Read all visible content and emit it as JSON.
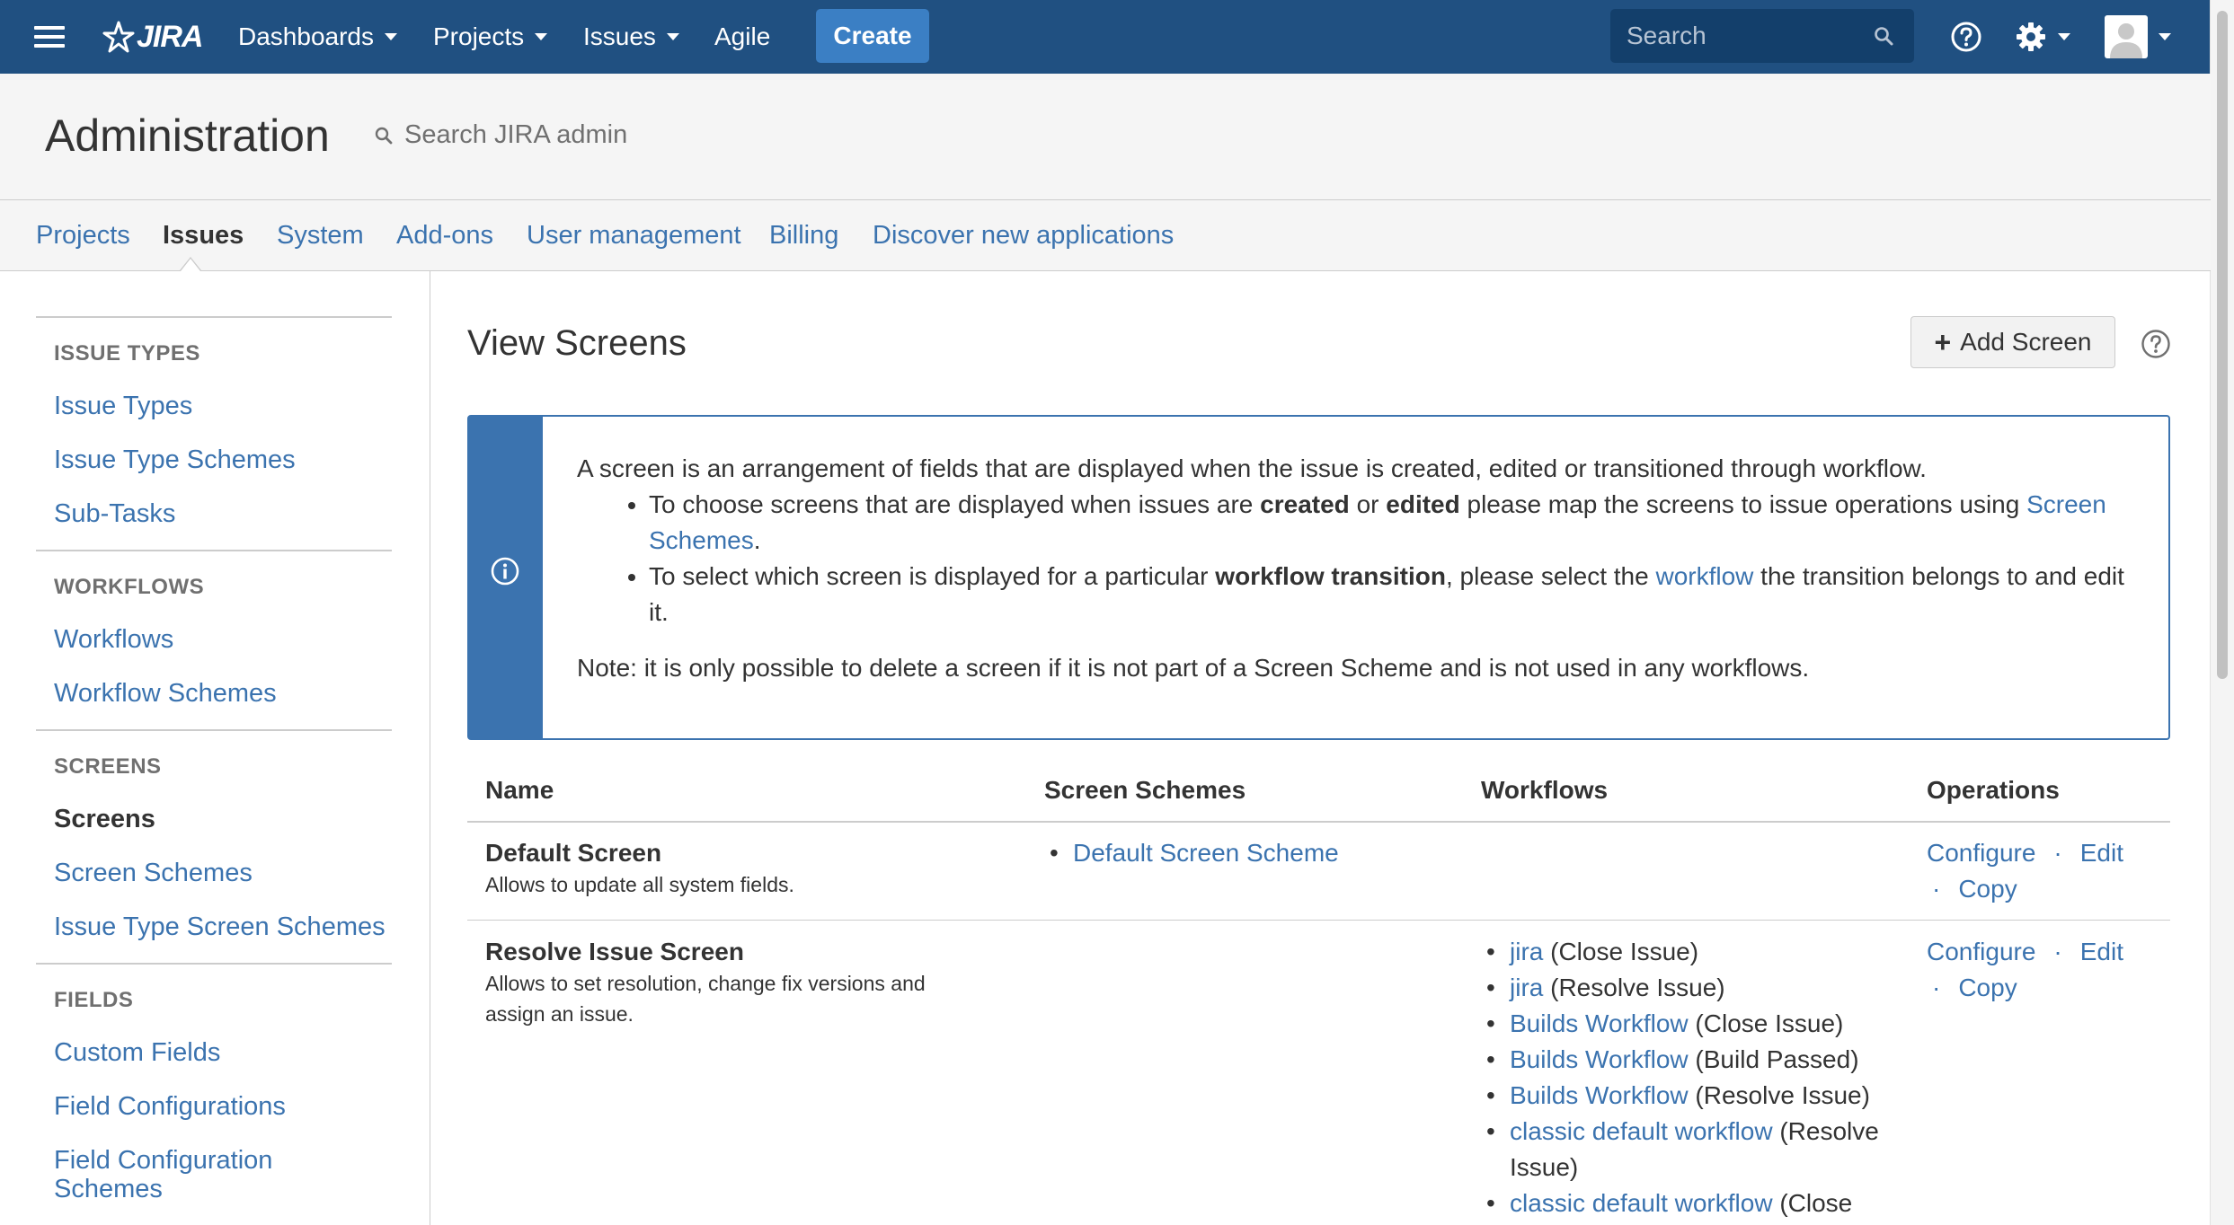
{
  "nav": {
    "logo_text": "JIRA",
    "dashboards": "Dashboards",
    "projects": "Projects",
    "issues": "Issues",
    "agile": "Agile",
    "create": "Create",
    "search_placeholder": "Search"
  },
  "admin": {
    "title": "Administration",
    "search_placeholder": "Search JIRA admin"
  },
  "tabs": [
    "Projects",
    "Issues",
    "System",
    "Add-ons",
    "User management",
    "Billing",
    "Discover new applications"
  ],
  "sidebar": {
    "issue_types_head": "ISSUE TYPES",
    "issue_types": "Issue Types",
    "issue_type_schemes": "Issue Type Schemes",
    "sub_tasks": "Sub-Tasks",
    "workflows_head": "WORKFLOWS",
    "workflows": "Workflows",
    "workflow_schemes": "Workflow Schemes",
    "screens_head": "SCREENS",
    "screens": "Screens",
    "screen_schemes": "Screen Schemes",
    "issue_type_screen_schemes": "Issue Type Screen Schemes",
    "fields_head": "FIELDS",
    "custom_fields": "Custom Fields",
    "field_configurations": "Field Configurations",
    "field_configuration_schemes_1": "Field Configuration",
    "field_configuration_schemes_2": "Schemes"
  },
  "main": {
    "title": "View Screens",
    "add_screen": "Add Screen"
  },
  "info": {
    "intro": "A screen is an arrangement of fields that are displayed when the issue is created, edited or transitioned through workflow.",
    "b1_pre": "To choose screens that are displayed when issues are ",
    "b1_bold1": "created",
    "b1_or": " or ",
    "b1_bold2": "edited",
    "b1_post": " please map the screens to issue operations using ",
    "b1_link": "Screen Schemes",
    "b1_end": ".",
    "b2_pre": "To select which screen is displayed for a particular ",
    "b2_bold": "workflow transition",
    "b2_mid": ", please select the ",
    "b2_link": "workflow",
    "b2_post": " the transition belongs to and edit it.",
    "note": "Note: it is only possible to delete a screen if it is not part of a Screen Scheme and is not used in any workflows."
  },
  "table": {
    "headers": {
      "name": "Name",
      "schemes": "Screen Schemes",
      "workflows": "Workflows",
      "ops": "Operations"
    },
    "ops": {
      "configure": "Configure",
      "edit": "Edit",
      "copy": "Copy",
      "sep": "·"
    },
    "rows": [
      {
        "name": "Default Screen",
        "desc": "Allows to update all system fields.",
        "scheme": "Default Screen Scheme"
      },
      {
        "name": "Resolve Issue Screen",
        "desc1": "Allows to set resolution, change fix versions and",
        "desc2": "assign an issue.",
        "workflows": [
          {
            "link": "jira",
            "tail": " (Close Issue)"
          },
          {
            "link": "jira",
            "tail": " (Resolve Issue)"
          },
          {
            "link": "Builds Workflow",
            "tail": " (Close Issue)"
          },
          {
            "link": "Builds Workflow",
            "tail": " (Build Passed)"
          },
          {
            "link": "Builds Workflow",
            "tail": " (Resolve Issue)"
          },
          {
            "link": "classic default workflow",
            "tail": " (Resolve",
            "tail2": "Issue)"
          },
          {
            "link": "classic default workflow",
            "tail": " (Close"
          }
        ]
      }
    ]
  }
}
